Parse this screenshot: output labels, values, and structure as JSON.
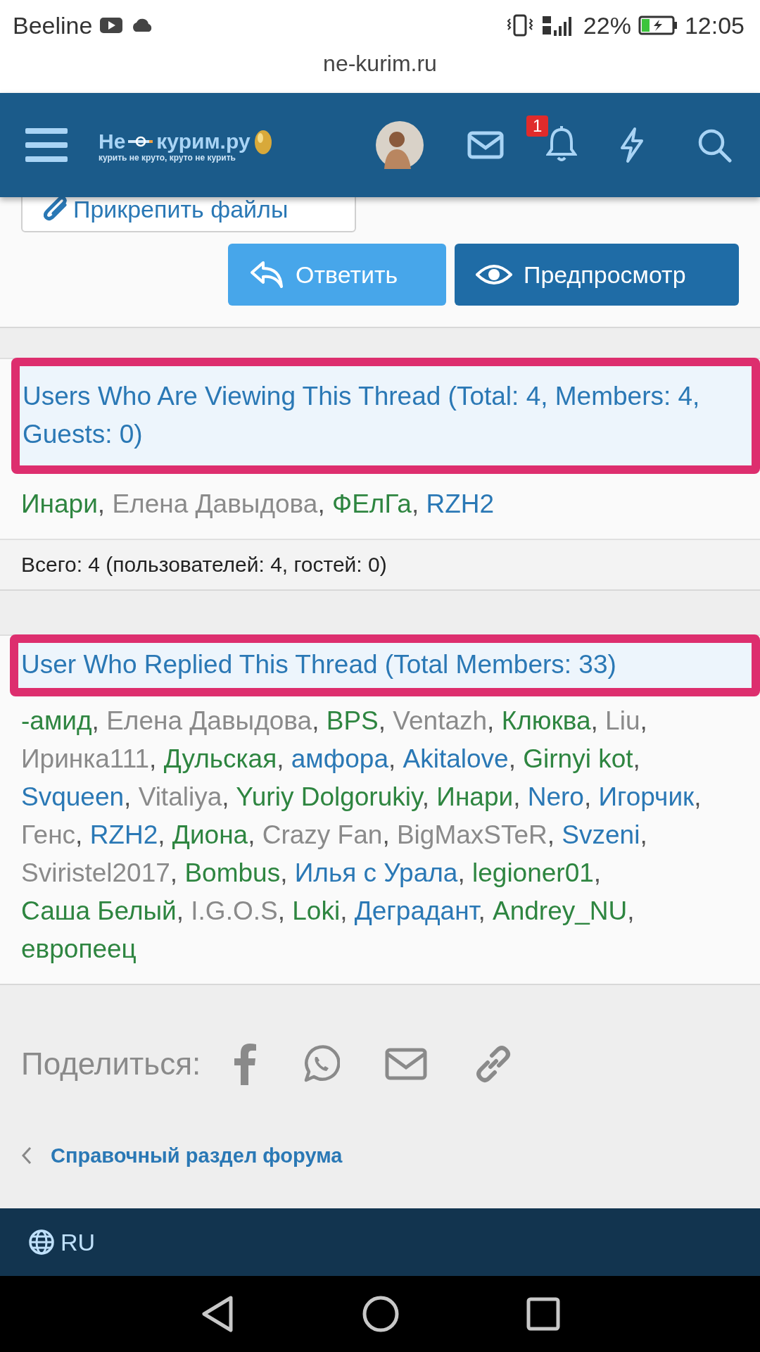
{
  "status_bar": {
    "carrier": "Beeline",
    "battery": "22%",
    "time": "12:05"
  },
  "url_bar": {
    "url": "ne-kurim.ru"
  },
  "header": {
    "logo": {
      "title_left": "Не",
      "title_right": "курим.ру",
      "tagline": "курить не круто, круто не курить"
    },
    "notification_count": "1"
  },
  "attach_button": {
    "label": "Прикрепить файлы"
  },
  "actions": [
    {
      "label": "Ответить",
      "kind": "reply"
    },
    {
      "label": "Предпросмотр",
      "kind": "preview"
    }
  ],
  "viewing": {
    "title": "Users Who Are Viewing This Thread (Total: 4, Members: 4, Guests: 0)",
    "highlighted": true,
    "users": [
      {
        "name": "Инари",
        "color": "#2e8540",
        "suffix": ","
      },
      {
        "name": "Елена Давыдова",
        "color": "#8a8a8a",
        "suffix": ","
      },
      {
        "name": "ФЕлГа",
        "color": "#2e8540",
        "suffix": ","
      },
      {
        "name": "RZH2",
        "color": "#2a78b5"
      }
    ],
    "summary": "Всего: 4 (пользователей: 4, гостей: 0)"
  },
  "replied": {
    "title": "User Who Replied This Thread (Total Members: 33)",
    "highlighted": true,
    "users": [
      {
        "name": "-амид",
        "color": "#2e8540",
        "suffix": ","
      },
      {
        "name": "Елена Давыдова",
        "color": "#8a8a8a",
        "suffix": ","
      },
      {
        "name": "BPS",
        "color": "#2e8540",
        "suffix": ","
      },
      {
        "name": "Ventazh",
        "color": "#8a8a8a",
        "suffix": ","
      },
      {
        "name": "Клюква",
        "color": "#2e8540",
        "suffix": ","
      },
      {
        "name": "Liu",
        "color": "#8a8a8a",
        "suffix": ","
      },
      {
        "name": "Иринка111",
        "color": "#8a8a8a",
        "suffix": ","
      },
      {
        "name": "Дульская",
        "color": "#2e8540",
        "suffix": ","
      },
      {
        "name": "амфора",
        "color": "#2a78b5",
        "suffix": ","
      },
      {
        "name": "Akitalove",
        "color": "#2a78b5",
        "suffix": ","
      },
      {
        "name": "Girnyi kot",
        "color": "#2e8540",
        "suffix": ","
      },
      {
        "name": "Svqueen",
        "color": "#2a78b5",
        "suffix": ","
      },
      {
        "name": "Vitaliya",
        "color": "#8a8a8a",
        "suffix": ","
      },
      {
        "name": "Yuriy Dolgorukiy",
        "color": "#2e8540",
        "suffix": ","
      },
      {
        "name": "Инари",
        "color": "#2e8540",
        "suffix": ","
      },
      {
        "name": "Nero",
        "color": "#2a78b5",
        "suffix": ","
      },
      {
        "name": "Игорчик",
        "color": "#2a78b5",
        "suffix": ","
      },
      {
        "name": "Генс",
        "color": "#8a8a8a",
        "suffix": ","
      },
      {
        "name": "RZH2",
        "color": "#2a78b5",
        "suffix": ","
      },
      {
        "name": "Диона",
        "color": "#2e8540",
        "suffix": ","
      },
      {
        "name": "Crazy Fan",
        "color": "#8a8a8a",
        "suffix": ","
      },
      {
        "name": "BigMaxSTeR",
        "color": "#8a8a8a",
        "suffix": ","
      },
      {
        "name": "Svzeni",
        "color": "#2a78b5",
        "suffix": ","
      },
      {
        "name": "Sviristel2017",
        "color": "#8a8a8a",
        "suffix": ","
      },
      {
        "name": "Bombus",
        "color": "#2e8540",
        "suffix": ","
      },
      {
        "name": "Илья с Урала",
        "color": "#2a78b5",
        "suffix": ","
      },
      {
        "name": "legioner01",
        "color": "#2e8540",
        "suffix": ","
      },
      {
        "name": "Саша Белый",
        "color": "#2e8540",
        "suffix": ","
      },
      {
        "name": "I.G.O.S",
        "color": "#8a8a8a",
        "suffix": ","
      },
      {
        "name": "Loki",
        "color": "#2e8540",
        "suffix": ","
      },
      {
        "name": "Деградант",
        "color": "#2a78b5",
        "suffix": ","
      },
      {
        "name": "Andrey_NU",
        "color": "#2e8540",
        "suffix": ","
      },
      {
        "name": "европеец",
        "color": "#2e8540"
      }
    ]
  },
  "share": {
    "label": "Поделиться:",
    "targets": [
      {
        "kind": "facebook"
      },
      {
        "kind": "whatsapp"
      },
      {
        "kind": "email"
      },
      {
        "kind": "link"
      }
    ]
  },
  "breadcrumb": {
    "label": "Справочный раздел форума"
  },
  "footer": {
    "language": "RU"
  }
}
